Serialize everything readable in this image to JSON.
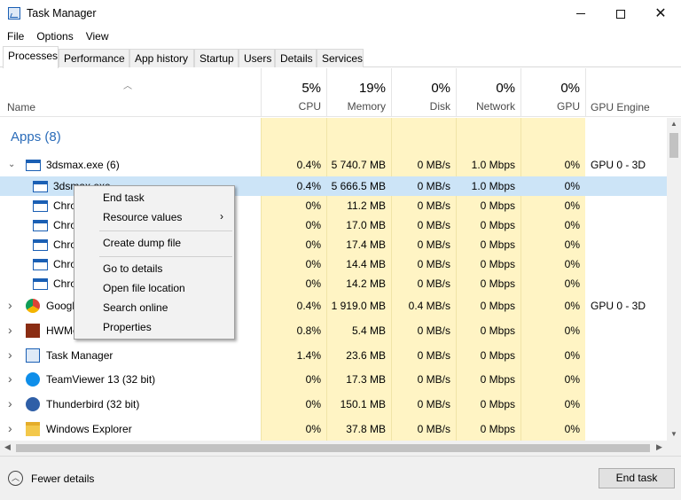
{
  "window": {
    "title": "Task Manager"
  },
  "menu": [
    "File",
    "Options",
    "View"
  ],
  "tabs": [
    "Processes",
    "Performance",
    "App history",
    "Startup",
    "Users",
    "Details",
    "Services"
  ],
  "columns": {
    "name": "Name",
    "cpu": {
      "pct": "5%",
      "label": "CPU"
    },
    "memory": {
      "pct": "19%",
      "label": "Memory"
    },
    "disk": {
      "pct": "0%",
      "label": "Disk"
    },
    "network": {
      "pct": "0%",
      "label": "Network"
    },
    "gpu": {
      "pct": "0%",
      "label": "GPU"
    },
    "gpu_engine": "GPU Engine"
  },
  "group": {
    "title": "Apps (8)"
  },
  "rows": [
    {
      "name": "3dsmax.exe (6)",
      "cpu": "0.4%",
      "memory": "5 740.7 MB",
      "disk": "0 MB/s",
      "network": "1.0 Mbps",
      "gpu": "0%",
      "gpu_engine": "GPU 0 - 3D"
    },
    {
      "name": "3dsmax.exe",
      "cpu": "0.4%",
      "memory": "5 666.5 MB",
      "disk": "0 MB/s",
      "network": "1.0 Mbps",
      "gpu": "0%",
      "gpu_engine": ""
    },
    {
      "name": "Chrome",
      "cpu": "0%",
      "memory": "11.2 MB",
      "disk": "0 MB/s",
      "network": "0 Mbps",
      "gpu": "0%",
      "gpu_engine": ""
    },
    {
      "name": "Chrome",
      "cpu": "0%",
      "memory": "17.0 MB",
      "disk": "0 MB/s",
      "network": "0 Mbps",
      "gpu": "0%",
      "gpu_engine": ""
    },
    {
      "name": "Chrome",
      "cpu": "0%",
      "memory": "17.4 MB",
      "disk": "0 MB/s",
      "network": "0 Mbps",
      "gpu": "0%",
      "gpu_engine": ""
    },
    {
      "name": "Chrome",
      "cpu": "0%",
      "memory": "14.4 MB",
      "disk": "0 MB/s",
      "network": "0 Mbps",
      "gpu": "0%",
      "gpu_engine": ""
    },
    {
      "name": "Chrome",
      "cpu": "0%",
      "memory": "14.2 MB",
      "disk": "0 MB/s",
      "network": "0 Mbps",
      "gpu": "0%",
      "gpu_engine": ""
    },
    {
      "name": "Google Chrome",
      "cpu": "0.4%",
      "memory": "1 919.0 MB",
      "disk": "0.4 MB/s",
      "network": "0 Mbps",
      "gpu": "0%",
      "gpu_engine": "GPU 0 - 3D"
    },
    {
      "name": "HWMonitor",
      "cpu": "0.8%",
      "memory": "5.4 MB",
      "disk": "0 MB/s",
      "network": "0 Mbps",
      "gpu": "0%",
      "gpu_engine": ""
    },
    {
      "name": "Task Manager",
      "cpu": "1.4%",
      "memory": "23.6 MB",
      "disk": "0 MB/s",
      "network": "0 Mbps",
      "gpu": "0%",
      "gpu_engine": ""
    },
    {
      "name": "TeamViewer 13 (32 bit)",
      "cpu": "0%",
      "memory": "17.3 MB",
      "disk": "0 MB/s",
      "network": "0 Mbps",
      "gpu": "0%",
      "gpu_engine": ""
    },
    {
      "name": "Thunderbird (32 bit)",
      "cpu": "0%",
      "memory": "150.1 MB",
      "disk": "0 MB/s",
      "network": "0 Mbps",
      "gpu": "0%",
      "gpu_engine": ""
    },
    {
      "name": "Windows Explorer",
      "cpu": "0%",
      "memory": "37.8 MB",
      "disk": "0 MB/s",
      "network": "0 Mbps",
      "gpu": "0%",
      "gpu_engine": ""
    }
  ],
  "context_menu": {
    "end_task": "End task",
    "resource_values": "Resource values",
    "submenu_arrow": "›",
    "create_dump": "Create dump file",
    "go_to_details": "Go to details",
    "open_file_location": "Open file location",
    "search_online": "Search online",
    "properties": "Properties"
  },
  "footer": {
    "fewer_details": "Fewer details",
    "end_task": "End task"
  },
  "icons": {
    "window": "window-icon",
    "chrome": "chrome-icon",
    "hwmonitor": "hwmonitor-icon",
    "taskmanager": "task-manager-icon",
    "teamviewer": "teamviewer-icon",
    "thunderbird": "thunderbird-icon",
    "explorer": "folder-icon"
  },
  "colors": {
    "heat": "#fff4c4",
    "selected": "#cce4f7",
    "group": "#2b6cb9"
  }
}
